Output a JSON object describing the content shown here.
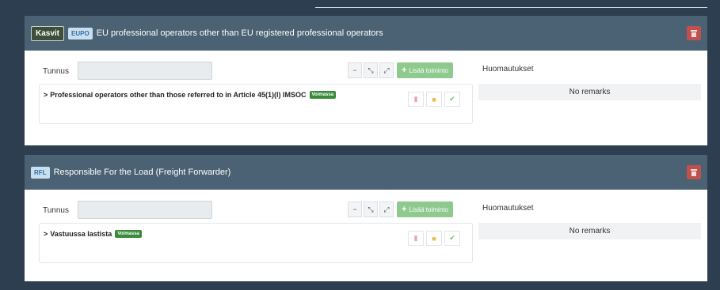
{
  "panels": [
    {
      "tag_primary": "Kasvit",
      "tag_code": "EUPO",
      "title": "EU professional operators other than EU registered professional operators",
      "tunnus_label": "Tunnus",
      "add_label": "Lisää toiminto",
      "operation": "Professional operators other than those referred to in Article 45(1)(l) IMSOC",
      "status": "Voimassa",
      "remarks_title": "Huomautukset",
      "remarks_value": "No remarks"
    },
    {
      "tag_code": "RFL",
      "title": "Responsible For the Load (Freight Forwarder)",
      "tunnus_label": "Tunnus",
      "add_label": "Lisää toiminto",
      "operation": "Vastuussa lastista",
      "status": "Voimassa",
      "remarks_title": "Huomautukset",
      "remarks_value": "No remarks"
    }
  ],
  "colors": {
    "header_bg": "#4a6273",
    "delete": "#c0504d",
    "add": "#8ec98e",
    "status": "#3a8a3a"
  }
}
